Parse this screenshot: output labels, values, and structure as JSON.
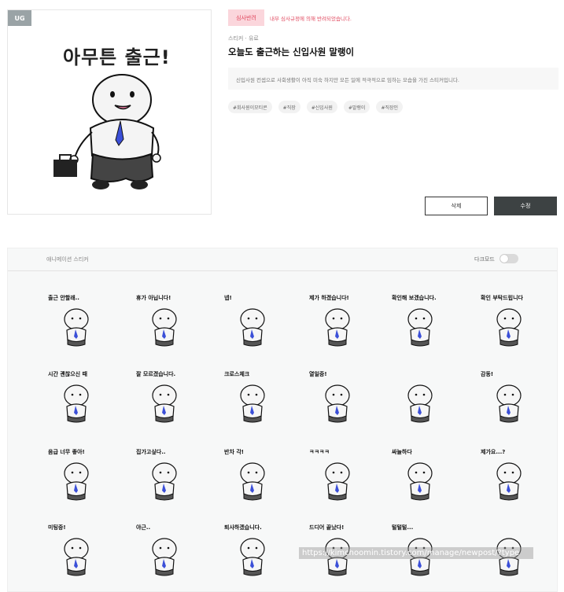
{
  "thumbnail": {
    "badge": "UG",
    "title": "아무튼 출근!"
  },
  "status": {
    "badge": "심사반려",
    "message": "내부 심사규정에 의해 반려되었습니다."
  },
  "breadcrumb": "스티커 · 유료",
  "title": "오늘도 출근하는 신입사원 말랭이",
  "description": "신입사원 컨셉으로 사회생활이 아직 미숙 하지만 모든 일에 적극적으로 임하는 모습을 가진 스티커입니다.",
  "tags": [
    "#회사원이모티콘",
    "#직장",
    "#신입사원",
    "#말랭이",
    "#직장인"
  ],
  "buttons": {
    "delete": "삭제",
    "edit": "수정"
  },
  "panel": {
    "title": "애니메이션 스티커",
    "dark_mode_label": "다크모드",
    "dark_mode_on": false
  },
  "stickers": [
    "출근 안할래..",
    "휴가 아닙니다!",
    "넵!",
    "제가 하겠습니다!",
    "확인해 보겠습니다.",
    "확인 부탁드립니다",
    "시간 괜찮으신 때",
    "잘 모르겠습니다.",
    "크로스체크",
    "열일중!",
    "",
    "감동!",
    "음급 너무 좋아!",
    "집가고싶다..",
    "반차 각!",
    "ㅋㅋㅋㅋ",
    "싸늘하다",
    "제가요...?",
    "미팅중!",
    "야근..",
    "퇴사하겠습니다.",
    "드디어 끝났다!",
    "털털털...",
    ""
  ],
  "url_overlay": "https://kimchoomin.tistory.com/manage/newpost/?type",
  "colors": {
    "accent_dark": "#3d4243",
    "status_red": "#e0485e",
    "status_bg": "#fbd6dc",
    "tie_blue": "#3b4fd8"
  }
}
